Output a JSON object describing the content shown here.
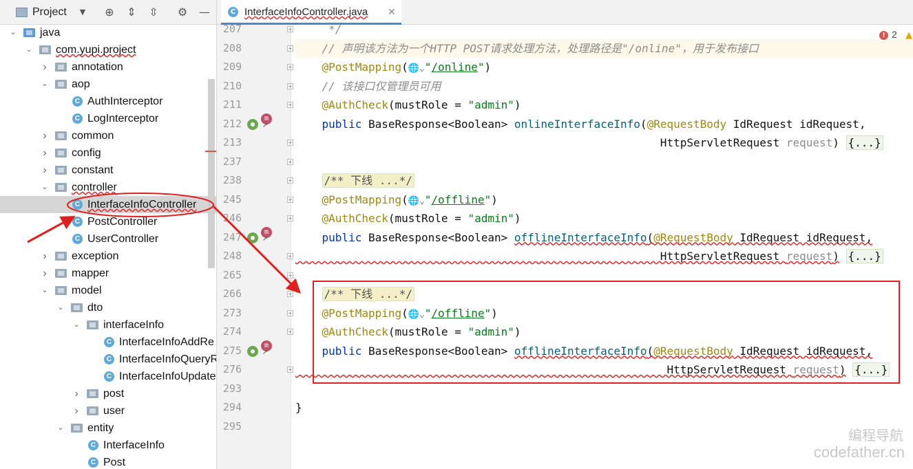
{
  "project_panel": {
    "title": "Project",
    "tree": [
      {
        "label": "java",
        "type": "folder-java",
        "level": 0,
        "expanded": true
      },
      {
        "label": "com.yupi.project",
        "type": "package",
        "level": 1,
        "expanded": true
      },
      {
        "label": "annotation",
        "type": "package",
        "level": 2,
        "expanded": false
      },
      {
        "label": "aop",
        "type": "package",
        "level": 2,
        "expanded": true
      },
      {
        "label": "AuthInterceptor",
        "type": "class",
        "level": 3
      },
      {
        "label": "LogInterceptor",
        "type": "class",
        "level": 3
      },
      {
        "label": "common",
        "type": "package",
        "level": 2,
        "expanded": false
      },
      {
        "label": "config",
        "type": "package",
        "level": 2,
        "expanded": false
      },
      {
        "label": "constant",
        "type": "package",
        "level": 2,
        "expanded": false
      },
      {
        "label": "controller",
        "type": "package",
        "level": 2,
        "expanded": true
      },
      {
        "label": "InterfaceInfoController",
        "type": "class",
        "level": 3,
        "selected": true
      },
      {
        "label": "PostController",
        "type": "class",
        "level": 3
      },
      {
        "label": "UserController",
        "type": "class",
        "level": 3
      },
      {
        "label": "exception",
        "type": "package",
        "level": 2,
        "expanded": false
      },
      {
        "label": "mapper",
        "type": "package",
        "level": 2,
        "expanded": false
      },
      {
        "label": "model",
        "type": "package",
        "level": 2,
        "expanded": true
      },
      {
        "label": "dto",
        "type": "package",
        "level": 3,
        "expanded": true
      },
      {
        "label": "interfaceInfo",
        "type": "package",
        "level": 4,
        "expanded": true
      },
      {
        "label": "InterfaceInfoAddRe",
        "type": "class",
        "level": 5
      },
      {
        "label": "InterfaceInfoQueryR",
        "type": "class",
        "level": 5
      },
      {
        "label": "InterfaceInfoUpdate",
        "type": "class",
        "level": 5
      },
      {
        "label": "post",
        "type": "package",
        "level": 4,
        "expanded": false
      },
      {
        "label": "user",
        "type": "package",
        "level": 4,
        "expanded": false
      },
      {
        "label": "entity",
        "type": "package",
        "level": 3,
        "expanded": true
      },
      {
        "label": "InterfaceInfo",
        "type": "class",
        "level": 4
      },
      {
        "label": "Post",
        "type": "class",
        "level": 4
      }
    ]
  },
  "editor": {
    "tab_label": "InterfaceInfoController.java",
    "error_count": "2",
    "lines": [
      {
        "n": "207",
        "html": "     <span class=\"c-comment\">*/</span>"
      },
      {
        "n": "208",
        "hl": true,
        "html": "    <span class=\"c-comment\">// 声明该方法为一个HTTP POST请求处理方法，处理路径是\"/online\"，用于发布接口</span>"
      },
      {
        "n": "209",
        "html": "    <span class=\"c-ann\">@PostMapping</span>(<span class=\"globe\">🌐⌄</span><span class=\"c-str\">\"<span class=\"c-ref\">/online</span>\"</span>)"
      },
      {
        "n": "210",
        "html": "    <span class=\"c-comment\">// 该接口仅管理员可用</span>"
      },
      {
        "n": "211",
        "html": "    <span class=\"c-ann\">@AuthCheck</span>(mustRole = <span class=\"c-str\">\"admin\"</span>)"
      },
      {
        "n": "212",
        "html": "    <span class=\"c-kw\">public</span> BaseResponse&lt;Boolean&gt; <span class=\"c-method\">onlineInterfaceInfo</span>(<span class=\"c-ann\">@RequestBody</span> IdRequest idRequest,"
      },
      {
        "n": "213",
        "html": "                                                       HttpServletRequest <span class=\"c-param\">request</span>) <span class=\"fold-box\">{...}</span>"
      },
      {
        "n": "237",
        "html": ""
      },
      {
        "n": "238",
        "html": "    <span class=\"doc-box\">/** 下线 ...*/</span>"
      },
      {
        "n": "245",
        "html": "    <span class=\"c-ann\">@PostMapping</span>(<span class=\"globe\">🌐⌄</span><span class=\"c-str\">\"<span class=\"c-ref\">/offline</span>\"</span>)"
      },
      {
        "n": "246",
        "html": "    <span class=\"c-ann\">@AuthCheck</span>(mustRole = <span class=\"c-str\">\"admin\"</span>)"
      },
      {
        "n": "247",
        "html": "    <span class=\"c-kw\">public</span> BaseResponse&lt;Boolean&gt; <span class=\"c-method wavy\">offlineInterfaceInfo</span><span class=\"wavy\">(<span class=\"c-ann\">@RequestBody</span> IdRequest idRequest,</span>"
      },
      {
        "n": "248",
        "html": "<span class=\"wavy\">                                                       HttpServletRequest <span class=\"c-param\">request</span>)</span> <span class=\"fold-box\">{...}</span>"
      },
      {
        "n": "265",
        "html": ""
      },
      {
        "n": "266",
        "html": "    <span class=\"doc-box\">/** 下线 ...*/</span>"
      },
      {
        "n": "273",
        "html": "    <span class=\"c-ann\">@PostMapping</span>(<span class=\"globe\">🌐⌄</span><span class=\"c-str\">\"<span class=\"c-ref\">/offline</span>\"</span>)"
      },
      {
        "n": "274",
        "html": "    <span class=\"c-ann\">@AuthCheck</span>(mustRole = <span class=\"c-str\">\"admin\"</span>)"
      },
      {
        "n": "275",
        "html": "    <span class=\"c-kw\">public</span> BaseResponse&lt;Boolean&gt; <span class=\"c-method wavy\">offlineInterfaceInfo</span><span class=\"wavy\">(<span class=\"c-ann\">@RequestBody</span> IdRequest idRequest,</span>"
      },
      {
        "n": "276",
        "html": "<span class=\"wavy\">                                                        HttpServletRequest <span class=\"c-param\">request</span>)</span> <span class=\"fold-box\">{...}</span>"
      },
      {
        "n": "293",
        "html": ""
      },
      {
        "n": "294",
        "html": "}"
      },
      {
        "n": "295",
        "html": ""
      }
    ]
  },
  "watermark": {
    "cn": "编程导航",
    "en": "codefather.cn"
  }
}
